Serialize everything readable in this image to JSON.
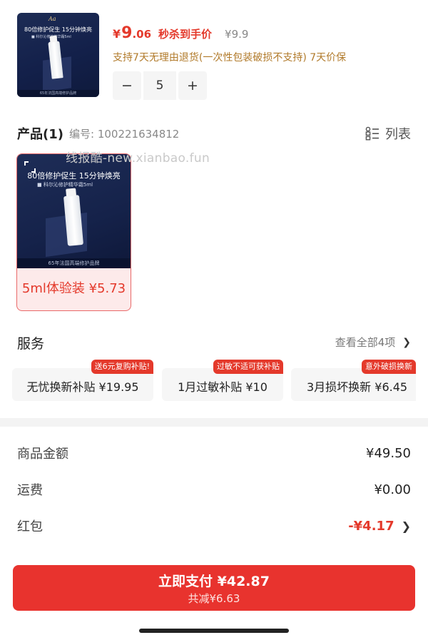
{
  "product": {
    "thumb_headline": "80倍修护促生 15分钟焕亮",
    "thumb_sub": "■ 科尔沁修护精华霜5ml",
    "thumb_footer": "65年法国高端修护品牌",
    "price_currency": "¥",
    "price_int": "9",
    "price_dec": ".06",
    "price_tag": "秒杀到手价",
    "price_original": "¥9.9",
    "return_policy": "支持7天无理由退货(一次性包装破损不支持) 7天价保",
    "quantity": "5",
    "minus_symbol": "−",
    "plus_symbol": "+"
  },
  "product_section": {
    "title": "产品(1)",
    "code": "编号: 100221634812",
    "list_toggle_label": "列表",
    "watermark": "线报酷-new.xianbao.fun",
    "variant": {
      "headline": "80倍修护促生 15分钟焕亮",
      "sub": "■ 科尔沁修护精华霜5ml",
      "footer": "65年法国高端修护品牌",
      "label": "5ml体验装 ¥5.73"
    }
  },
  "services": {
    "title": "服务",
    "view_all": "查看全部4项",
    "items": [
      {
        "label": "无忧换新补贴  ¥19.95",
        "badge": "送6元复购补贴!"
      },
      {
        "label": "1月过敏补贴  ¥10",
        "badge": "过敏不适可获补贴"
      },
      {
        "label": "3月损坏换新  ¥6.45",
        "badge": "意外破损换新"
      }
    ]
  },
  "summary": {
    "goods_label": "商品金额",
    "goods_value": "¥49.50",
    "shipping_label": "运费",
    "shipping_value": "¥0.00",
    "coupon_label": "红包",
    "coupon_value": "-¥4.17"
  },
  "pay": {
    "main": "立即支付 ¥42.87",
    "sub": "共减¥6.63"
  },
  "colors": {
    "accent_red": "#e4392b",
    "policy_gold": "#b17a2a",
    "pay_button": "#e8332e"
  }
}
